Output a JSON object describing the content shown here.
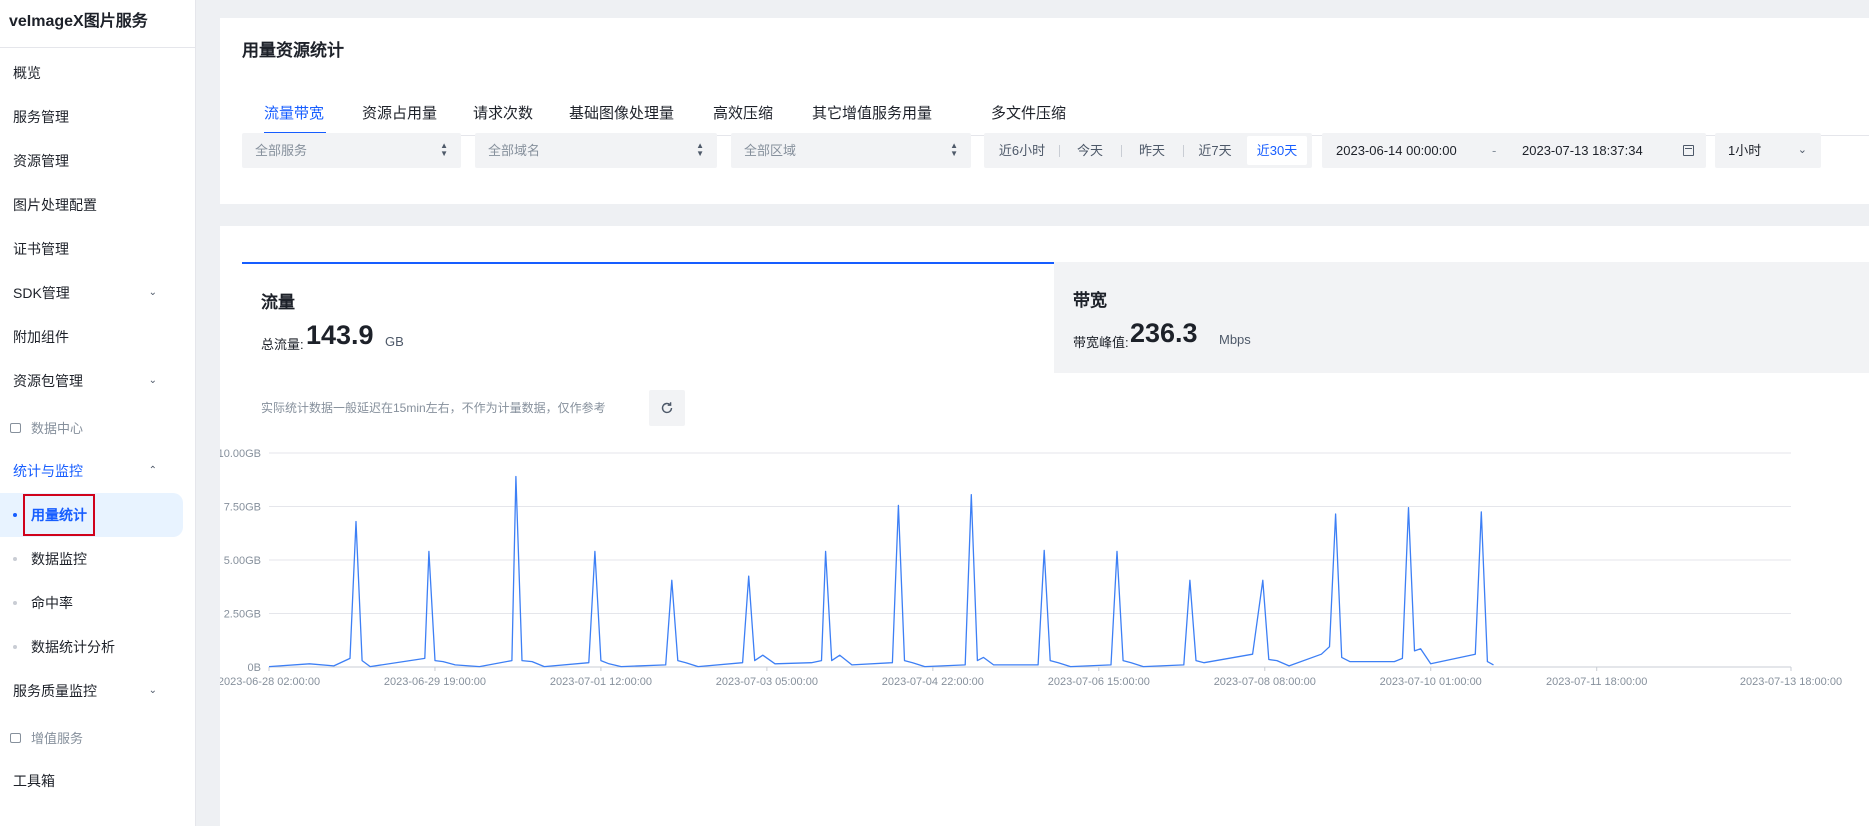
{
  "sidebar": {
    "brand": "veImageX图片服务",
    "items": [
      {
        "label": "概览"
      },
      {
        "label": "服务管理"
      },
      {
        "label": "资源管理"
      },
      {
        "label": "图片处理配置"
      },
      {
        "label": "证书管理"
      },
      {
        "label": "SDK管理"
      },
      {
        "label": "附加组件"
      },
      {
        "label": "资源包管理"
      }
    ],
    "group_data_center": "数据中心",
    "stats_monitor": "统计与监控",
    "subitems": [
      {
        "label": "用量统计"
      },
      {
        "label": "数据监控"
      },
      {
        "label": "命中率"
      },
      {
        "label": "数据统计分析"
      }
    ],
    "quality_monitor": "服务质量监控",
    "group_value_added": "增值服务",
    "toolbox": "工具箱"
  },
  "header": {
    "title": "用量资源统计",
    "tabs": [
      {
        "label": "流量带宽"
      },
      {
        "label": "资源占用量"
      },
      {
        "label": "请求次数"
      },
      {
        "label": "基础图像处理量"
      },
      {
        "label": "高效压缩"
      },
      {
        "label": "其它增值服务用量"
      },
      {
        "label": "多文件压缩"
      }
    ]
  },
  "filters": {
    "service": "全部服务",
    "domain": "全部域名",
    "region": "全部区域",
    "quick_ranges": [
      "近6小时",
      "今天",
      "昨天",
      "近7天",
      "近30天"
    ],
    "active_range": "近30天",
    "start": "2023-06-14 00:00:00",
    "separator": "-",
    "end": "2023-07-13 18:37:34",
    "granularity": "1小时"
  },
  "metrics": {
    "traffic": {
      "title": "流量",
      "label": "总流量:",
      "value": "143.9",
      "unit": "GB"
    },
    "bandwidth": {
      "title": "带宽",
      "label": "带宽峰值:",
      "value": "236.3",
      "unit": "Mbps"
    }
  },
  "note": "实际统计数据一般延迟在15min左右，不作为计量数据，仅作参考",
  "colors": {
    "accent": "#165dff",
    "line": "#3d7ff5",
    "highlight": "#d0021b"
  },
  "chart_data": {
    "type": "line",
    "title": "",
    "xlabel": "",
    "ylabel": "",
    "series": [
      {
        "values": [
          [
            "2023-06-28 02:00:00",
            0.02
          ],
          [
            "2023-06-28 12:00:00",
            0.15
          ],
          [
            "2023-06-28 18:00:00",
            0.05
          ],
          [
            "2023-06-28 22:00:00",
            0.4
          ],
          [
            "2023-06-28 23:30:00",
            6.8
          ],
          [
            "2023-06-29 01:00:00",
            0.3
          ],
          [
            "2023-06-29 03:00:00",
            0.02
          ],
          [
            "2023-06-29 16:30:00",
            0.4
          ],
          [
            "2023-06-29 17:30:00",
            5.4
          ],
          [
            "2023-06-29 19:00:00",
            0.3
          ],
          [
            "2023-06-29 21:00:00",
            0.25
          ],
          [
            "2023-06-30 00:00:00",
            0.1
          ],
          [
            "2023-06-30 06:00:00",
            0.02
          ],
          [
            "2023-06-30 14:00:00",
            0.3
          ],
          [
            "2023-06-30 15:00:00",
            8.9
          ],
          [
            "2023-06-30 16:30:00",
            0.3
          ],
          [
            "2023-06-30 19:00:00",
            0.25
          ],
          [
            "2023-06-30 22:00:00",
            0.02
          ],
          [
            "2023-07-01 09:00:00",
            0.2
          ],
          [
            "2023-07-01 10:30:00",
            5.4
          ],
          [
            "2023-07-01 12:00:00",
            0.3
          ],
          [
            "2023-07-01 14:00:00",
            0.15
          ],
          [
            "2023-07-01 17:00:00",
            0.02
          ],
          [
            "2023-07-02 04:00:00",
            0.1
          ],
          [
            "2023-07-02 05:30:00",
            4.05
          ],
          [
            "2023-07-02 07:00:00",
            0.3
          ],
          [
            "2023-07-02 09:00:00",
            0.2
          ],
          [
            "2023-07-02 12:00:00",
            0.02
          ],
          [
            "2023-07-02 23:00:00",
            0.2
          ],
          [
            "2023-07-03 00:30:00",
            4.25
          ],
          [
            "2023-07-03 02:00:00",
            0.3
          ],
          [
            "2023-07-03 04:00:00",
            0.55
          ],
          [
            "2023-07-03 07:00:00",
            0.15
          ],
          [
            "2023-07-03 16:00:00",
            0.2
          ],
          [
            "2023-07-03 18:30:00",
            0.3
          ],
          [
            "2023-07-03 19:30:00",
            5.4
          ],
          [
            "2023-07-03 21:00:00",
            0.3
          ],
          [
            "2023-07-03 23:00:00",
            0.55
          ],
          [
            "2023-07-04 02:00:00",
            0.1
          ],
          [
            "2023-07-04 12:00:00",
            0.2
          ],
          [
            "2023-07-04 13:30:00",
            7.55
          ],
          [
            "2023-07-04 15:00:00",
            0.3
          ],
          [
            "2023-07-04 17:00:00",
            0.2
          ],
          [
            "2023-07-04 20:00:00",
            0.02
          ],
          [
            "2023-07-05 06:00:00",
            0.1
          ],
          [
            "2023-07-05 07:30:00",
            8.05
          ],
          [
            "2023-07-05 09:00:00",
            0.3
          ],
          [
            "2023-07-05 10:30:00",
            0.45
          ],
          [
            "2023-07-05 13:00:00",
            0.1
          ],
          [
            "2023-07-06 00:00:00",
            0.1
          ],
          [
            "2023-07-06 01:30:00",
            5.45
          ],
          [
            "2023-07-06 03:00:00",
            0.3
          ],
          [
            "2023-07-06 05:00:00",
            0.2
          ],
          [
            "2023-07-06 08:00:00",
            0.02
          ],
          [
            "2023-07-06 18:00:00",
            0.1
          ],
          [
            "2023-07-06 19:30:00",
            5.4
          ],
          [
            "2023-07-06 21:00:00",
            0.3
          ],
          [
            "2023-07-06 23:00:00",
            0.2
          ],
          [
            "2023-07-07 02:00:00",
            0.02
          ],
          [
            "2023-07-07 12:00:00",
            0.1
          ],
          [
            "2023-07-07 13:30:00",
            4.05
          ],
          [
            "2023-07-07 15:00:00",
            0.3
          ],
          [
            "2023-07-07 17:00:00",
            0.2
          ],
          [
            "2023-07-08 05:00:00",
            0.6
          ],
          [
            "2023-07-08 07:30:00",
            4.05
          ],
          [
            "2023-07-08 09:00:00",
            0.35
          ],
          [
            "2023-07-08 11:00:00",
            0.3
          ],
          [
            "2023-07-08 14:00:00",
            0.05
          ],
          [
            "2023-07-08 22:00:00",
            0.6
          ],
          [
            "2023-07-09 00:00:00",
            0.95
          ],
          [
            "2023-07-09 01:30:00",
            7.15
          ],
          [
            "2023-07-09 03:00:00",
            0.45
          ],
          [
            "2023-07-09 05:00:00",
            0.25
          ],
          [
            "2023-07-09 16:00:00",
            0.25
          ],
          [
            "2023-07-09 18:00:00",
            0.4
          ],
          [
            "2023-07-09 19:30:00",
            7.45
          ],
          [
            "2023-07-09 21:00:00",
            0.75
          ],
          [
            "2023-07-09 22:30:00",
            0.85
          ],
          [
            "2023-07-10 01:00:00",
            0.15
          ],
          [
            "2023-07-10 12:00:00",
            0.6
          ],
          [
            "2023-07-10 13:30:00",
            7.25
          ],
          [
            "2023-07-10 15:00:00",
            0.25
          ],
          [
            "2023-07-10 16:30:00",
            0.1
          ]
        ]
      }
    ],
    "x_tick_labels": [
      "2023-06-28 02:00:00",
      "2023-06-29 19:00:00",
      "2023-07-01 12:00:00",
      "2023-07-03 05:00:00",
      "2023-07-04 22:00:00",
      "2023-07-06 15:00:00",
      "2023-07-08 08:00:00",
      "2023-07-10 01:00:00",
      "2023-07-11 18:00:00",
      "2023-07-13 18:00:00"
    ],
    "y_tick_labels": [
      "0B",
      "2.50GB",
      "5.00GB",
      "7.50GB",
      "10.00GB"
    ],
    "ylim": [
      0,
      10
    ],
    "grid": true
  }
}
